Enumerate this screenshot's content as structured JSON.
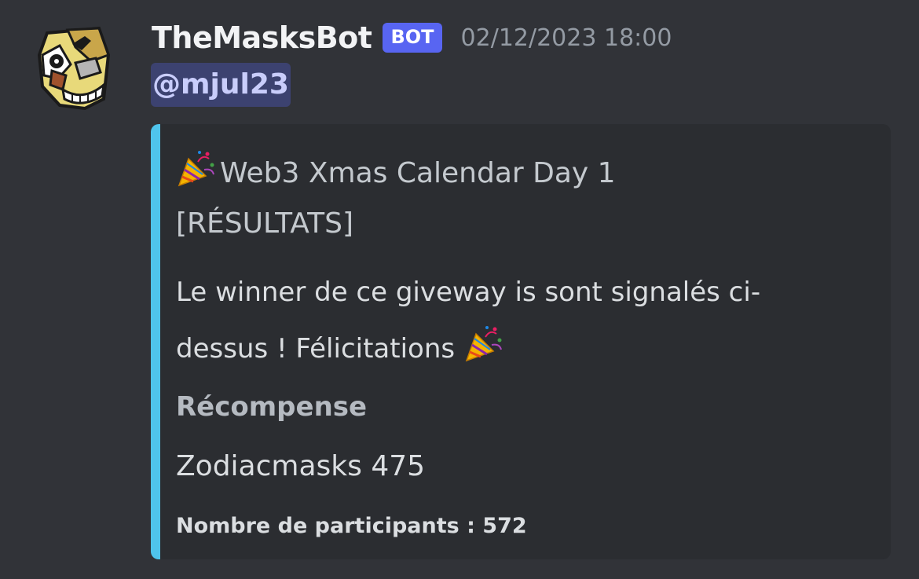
{
  "message": {
    "author": "TheMasksBot",
    "badge": "BOT",
    "timestamp": "02/12/2023 18:00",
    "mention": "@mjul23"
  },
  "embed": {
    "accent_color": "#4fc4ec",
    "title_emoji": "party-popper-icon",
    "title": "Web3 Xmas Calendar Day 1 [RÉSULTATS]",
    "description": "Le winner de ce giveway is sont signalés ci-dessus ! Félicitations",
    "description_emoji": "party-popper-icon",
    "field": {
      "name": "Récompense",
      "value": "Zodiacmasks 475"
    },
    "footer": "Nombre de participants : 572"
  },
  "colors": {
    "background": "#313338",
    "embed_background": "#2b2d31",
    "badge": "#5865f2",
    "mention_background": "#3c4270"
  }
}
